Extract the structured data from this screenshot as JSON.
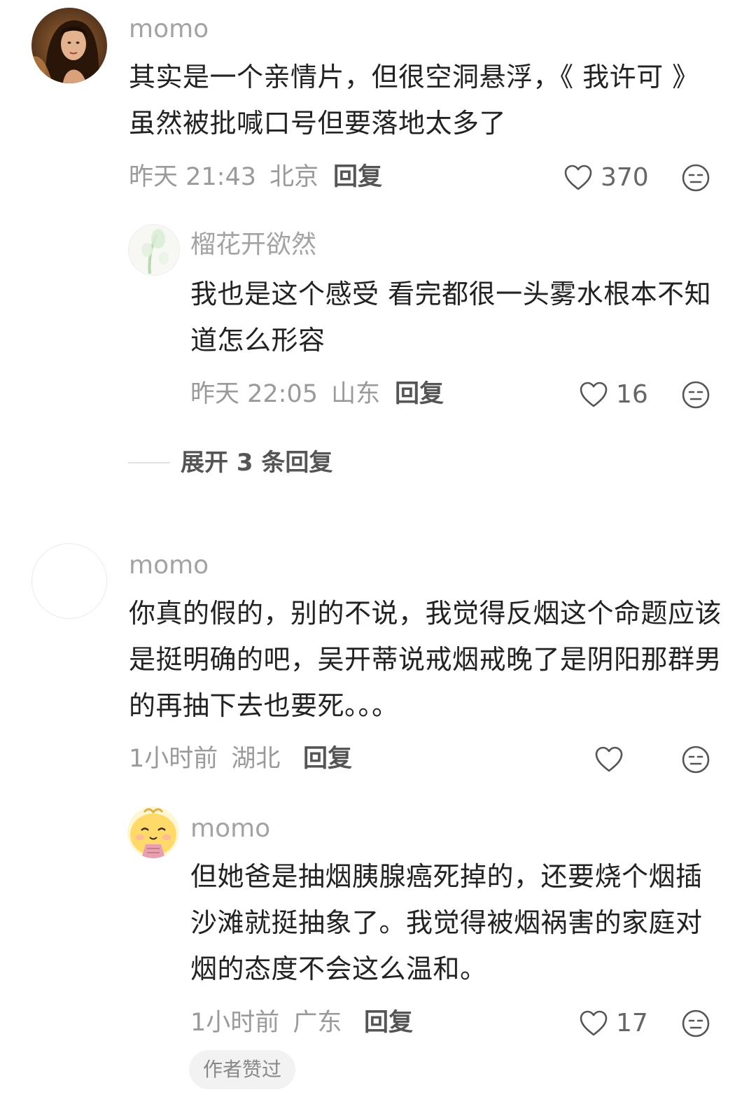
{
  "comments": [
    {
      "username": "momo",
      "avatar_icon": "portrait-photo-avatar",
      "content": "其实是一个亲情片，但很空洞悬浮，《 我许可 》虽然被批喊口号但要落地太多了",
      "time": "昨天 21:43",
      "location": "北京",
      "reply_label": "回复",
      "likes": "370",
      "replies": [
        {
          "username": "榴花开欲然",
          "avatar_icon": "faded-flower-avatar",
          "content": "我也是这个感受 看完都很一头雾水根本不知道怎么形容",
          "time": "昨天 22:05",
          "location": "山东",
          "reply_label": "回复",
          "likes": "16"
        }
      ],
      "expand_label": "展开 3 条回复"
    },
    {
      "username": "momo",
      "avatar_icon": "blank-avatar",
      "content": "你真的假的，别的不说，我觉得反烟这个命题应该是挺明确的吧，吴开蒂说戒烟戒晚了是阴阳那群男的再抽下去也要死。。。",
      "time": "1小时前",
      "location": "湖北",
      "reply_label": "回复",
      "likes": "",
      "replies": [
        {
          "username": "momo",
          "avatar_icon": "cartoon-chick-avatar",
          "content": "但她爸是抽烟胰腺癌死掉的，还要烧个烟插沙滩就挺抽象了。我觉得被烟祸害的家庭对烟的态度不会这么温和。",
          "time": "1小时前",
          "location": "广东",
          "reply_label": "回复",
          "likes": "17",
          "badge": "作者赞过"
        }
      ]
    }
  ]
}
